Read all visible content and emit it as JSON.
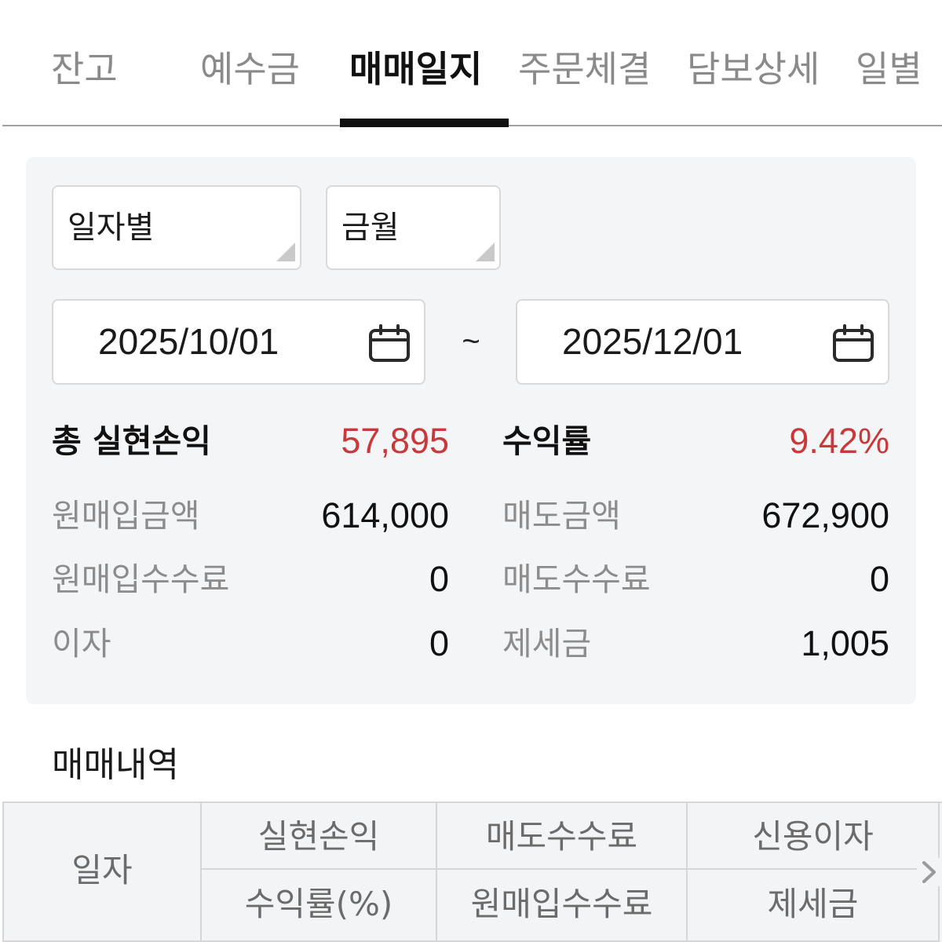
{
  "tabs": [
    {
      "label": "잔고",
      "active": false
    },
    {
      "label": "예수금",
      "active": false
    },
    {
      "label": "매매일지",
      "active": true
    },
    {
      "label": "주문체결",
      "active": false
    },
    {
      "label": "담보상세",
      "active": false
    },
    {
      "label": "일별",
      "active": false
    }
  ],
  "filters": {
    "period_type": "일자별",
    "period_preset": "금월",
    "start_date": "2025/10/01",
    "date_separator": "~",
    "end_date": "2025/12/01"
  },
  "summary": {
    "realized_pnl": {
      "label": "총 실현손익",
      "value": "57,895"
    },
    "return_rate": {
      "label": "수익률",
      "value": "9.42%"
    },
    "rows": [
      {
        "left_label": "원매입금액",
        "left_value": "614,000",
        "right_label": "매도금액",
        "right_value": "672,900"
      },
      {
        "left_label": "원매입수수료",
        "left_value": "0",
        "right_label": "매도수수료",
        "right_value": "0"
      },
      {
        "left_label": "이자",
        "left_value": "0",
        "right_label": "제세금",
        "right_value": "1,005"
      }
    ]
  },
  "history": {
    "title": "매매내역",
    "header": {
      "date": "일자",
      "columns": [
        {
          "top": "실현손익",
          "bottom": "수익률(%)"
        },
        {
          "top": "매도수수료",
          "bottom": "원매입수수료"
        },
        {
          "top": "신용이자",
          "bottom": "제세금"
        }
      ]
    }
  },
  "icons": {
    "select_caret": "select-caret-icon",
    "date_picker": "calendar-icon",
    "scroll_more": "chevron-right-icon"
  },
  "colors": {
    "accent": "#c8393b",
    "active_tab": "#111111",
    "inactive_tab": "#8a8a8a",
    "panel": "#f4f5f7",
    "label": "#8c8c8c",
    "table_bg": "#f3f4f6"
  }
}
